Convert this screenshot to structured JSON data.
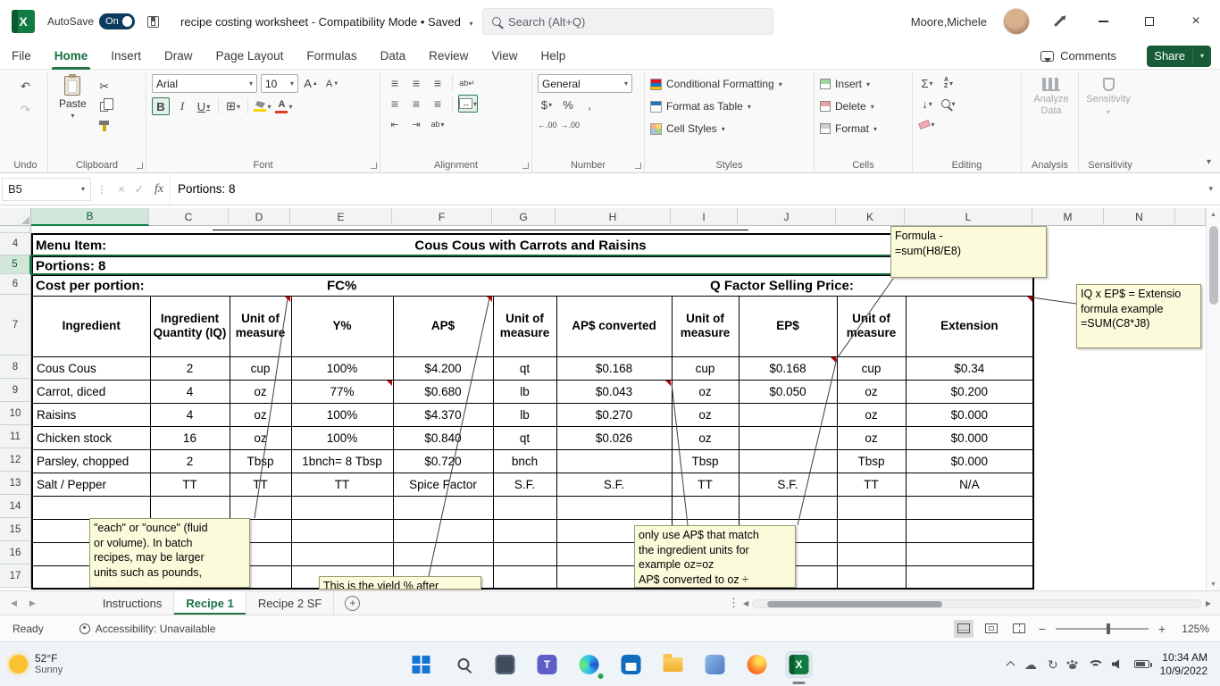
{
  "titlebar": {
    "autosave_label": "AutoSave",
    "autosave_state": "On",
    "doc_title_full": "recipe costing worksheet  -  Compatibility Mode • Saved",
    "search_placeholder": "Search (Alt+Q)",
    "user_name": "Moore,Michele"
  },
  "ribbon_tabs": [
    "File",
    "Home",
    "Insert",
    "Draw",
    "Page Layout",
    "Formulas",
    "Data",
    "Review",
    "View",
    "Help"
  ],
  "active_tab": "Home",
  "actions": {
    "comments_label": "Comments",
    "share_label": "Share"
  },
  "ribbon": {
    "group_labels": [
      "Undo",
      "Clipboard",
      "Font",
      "Alignment",
      "Number",
      "Styles",
      "Cells",
      "Editing",
      "Analysis",
      "Sensitivity"
    ],
    "paste_label": "Paste",
    "font_name": "Arial",
    "font_size": "10",
    "number_format": "General",
    "styles_items": [
      "Conditional Formatting",
      "Format as Table",
      "Cell Styles"
    ],
    "cells_items": [
      "Insert",
      "Delete",
      "Format"
    ],
    "analyze_label": "Analyze Data",
    "sensitivity_label": "Sensitivity"
  },
  "formula_bar": {
    "name_box": "B5",
    "content": "Portions: 8"
  },
  "grid": {
    "columns": [
      "B",
      "C",
      "D",
      "E",
      "F",
      "G",
      "H",
      "I",
      "J",
      "K",
      "L",
      "M",
      "N"
    ],
    "rows": [
      "4",
      "5",
      "6",
      "7",
      "8",
      "9",
      "10",
      "11",
      "12",
      "13",
      "14",
      "15",
      "16",
      "17"
    ],
    "selected_col": "B",
    "selected_row": "5",
    "active_cell": "B5",
    "menu_item_label": "Menu Item:",
    "menu_item_value": "Cous Cous with Carrots and Raisins",
    "portions": "Portions: 8",
    "cost_label": "Cost per portion:",
    "fc_label": "FC%",
    "q_factor_label": "Q Factor Selling Price:",
    "headers": [
      "Ingredient",
      "Ingredient Quantity (IQ)",
      "Unit of measure",
      "Y%",
      "AP$",
      "Unit of measure",
      "AP$ converted",
      "Unit of measure",
      "EP$",
      "Unit of measure",
      "Extension"
    ],
    "data_rows": [
      [
        "Cous Cous",
        "2",
        "cup",
        "100%",
        "$4.200",
        "qt",
        "$0.168",
        "cup",
        "$0.168",
        "cup",
        "$0.34"
      ],
      [
        "Carrot, diced",
        "4",
        "oz",
        "77%",
        "$0.680",
        "lb",
        "$0.043",
        "oz",
        "$0.050",
        "oz",
        "$0.200"
      ],
      [
        "Raisins",
        "4",
        "oz",
        "100%",
        "$4.370",
        "lb",
        "$0.270",
        "oz",
        "",
        "oz",
        "$0.000"
      ],
      [
        "Chicken stock",
        "16",
        "oz",
        "100%",
        "$0.840",
        "qt",
        "$0.026",
        "oz",
        "",
        "oz",
        "$0.000"
      ],
      [
        "Parsley, chopped",
        "2",
        "Tbsp",
        "1bnch= 8 Tbsp",
        "$0.720",
        "bnch",
        "",
        "Tbsp",
        "",
        "Tbsp",
        "$0.000"
      ],
      [
        "Salt / Pepper",
        "TT",
        "TT",
        "TT",
        "Spice Factor",
        "S.F.",
        "S.F.",
        "TT",
        "S.F.",
        "TT",
        "N/A"
      ]
    ],
    "notes": {
      "formula_note": "Formula -\n=sum(H8/E8)",
      "extension_note": "IQ x EP$ = Extensio\nformula example\n=SUM(C8*J8)",
      "units_note": "\"each\" or \"ounce\" (fluid\nor volume). In batch\nrecipes, may be larger\nunits such as pounds,",
      "yield_note": "This is the yield % after",
      "ap_note": "only use AP$ that match\nthe ingredient units for\nexample oz=oz\nAP$ converted to oz ÷"
    }
  },
  "sheet_tabs": {
    "tabs": [
      "Instructions",
      "Recipe 1",
      "Recipe 2 SF"
    ],
    "active": "Recipe 1"
  },
  "status_bar": {
    "ready_label": "Ready",
    "accessibility_label": "Accessibility: Unavailable",
    "zoom_level": "125%"
  },
  "taskbar": {
    "weather_temp": "52°F",
    "weather_desc": "Sunny",
    "apps": [
      "start",
      "search",
      "task-view",
      "teams",
      "edge",
      "store",
      "file-explorer",
      "photos",
      "firefox",
      "excel"
    ],
    "active_app": "excel",
    "time": "10:34 AM",
    "date": "10/9/2022"
  }
}
